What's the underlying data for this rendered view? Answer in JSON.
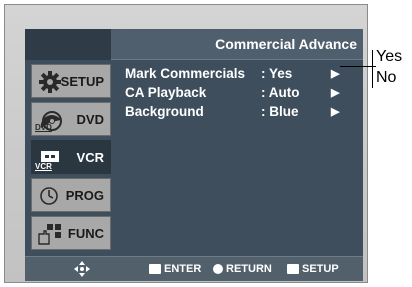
{
  "title": "Commercial Advance",
  "sidebar": {
    "items": [
      {
        "label": "SETUP",
        "icon": "gear-icon"
      },
      {
        "label": "DVD",
        "icon": "dvd-icon",
        "badge": "DVD"
      },
      {
        "label": "VCR",
        "icon": "vcr-icon",
        "badge": "VCR"
      },
      {
        "label": "PROG",
        "icon": "clock-icon"
      },
      {
        "label": "FUNC",
        "icon": "function-icon"
      }
    ],
    "active": "VCR"
  },
  "menu": {
    "items": [
      {
        "label": "Mark Commercials",
        "value": ": Yes",
        "arrow": "▶"
      },
      {
        "label": "CA Playback",
        "value": ": Auto",
        "arrow": "▶"
      },
      {
        "label": "Background",
        "value": ": Blue",
        "arrow": "▶"
      }
    ]
  },
  "footer": {
    "enter": "ENTER",
    "return": "RETURN",
    "setup": "SETUP"
  },
  "callout": {
    "options": [
      "Yes",
      "No"
    ]
  }
}
